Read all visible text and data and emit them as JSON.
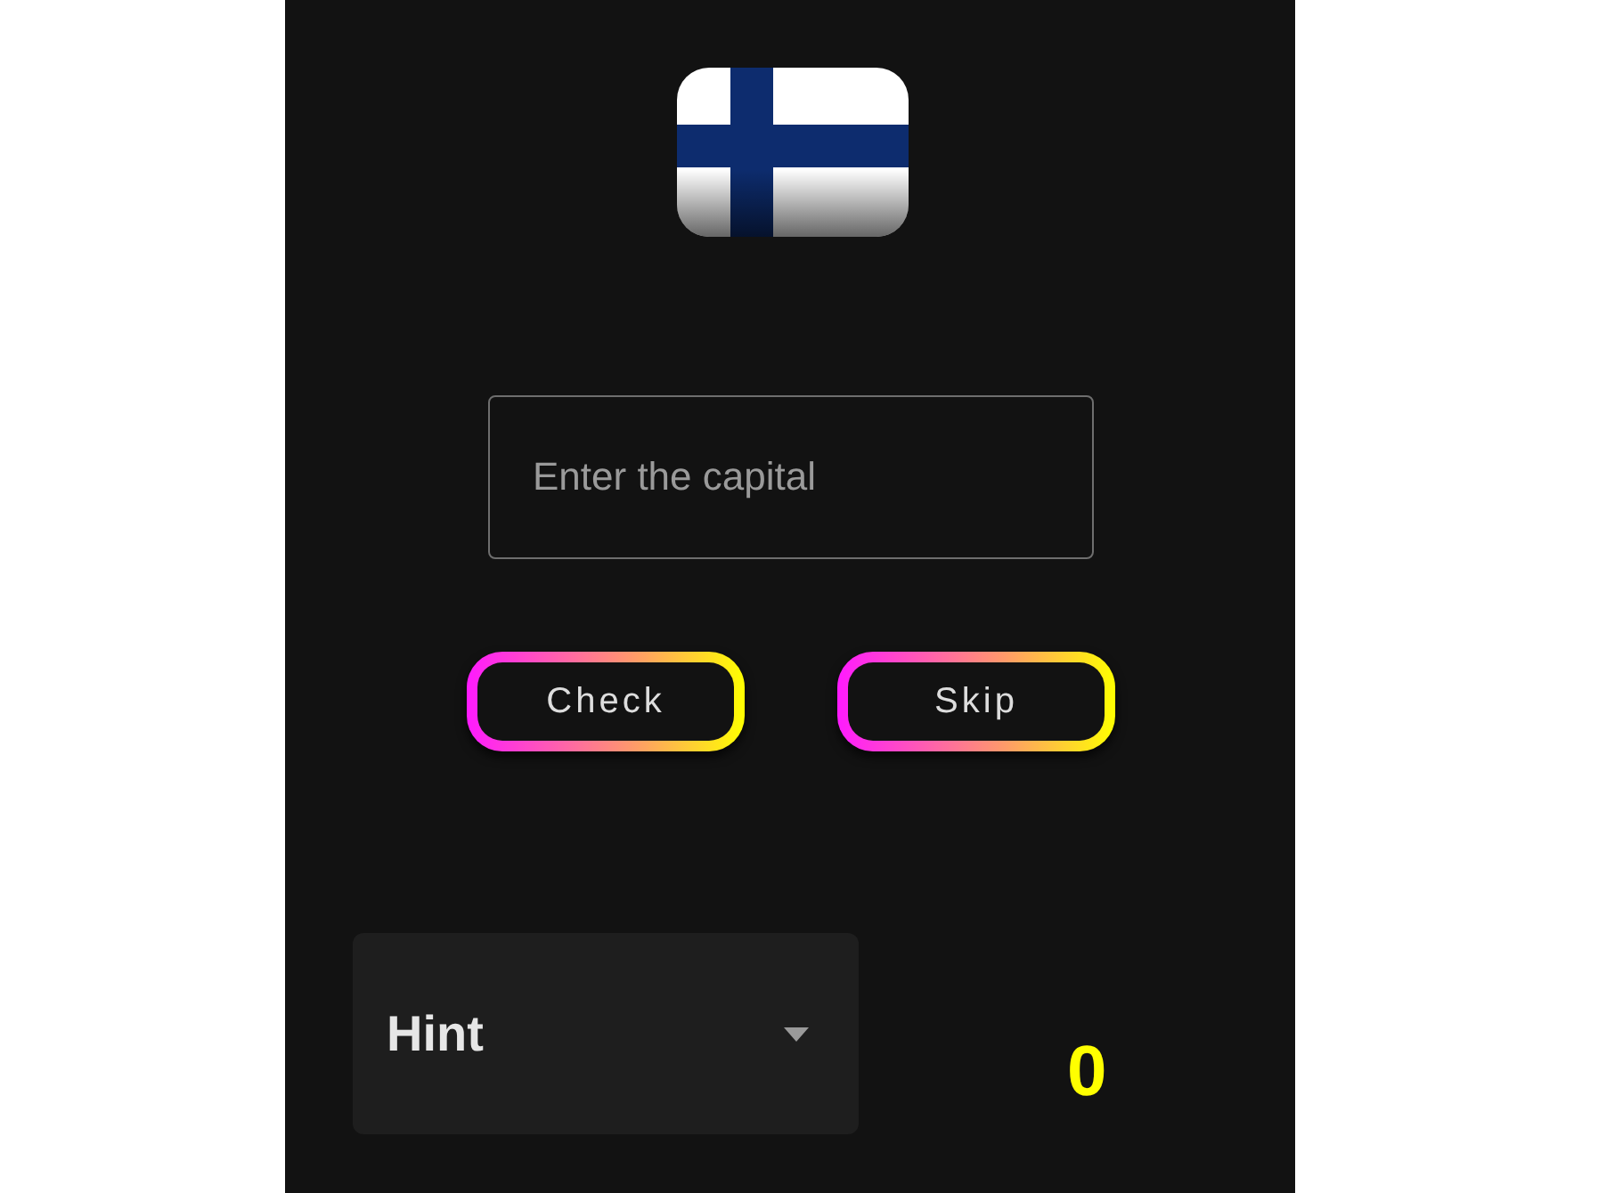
{
  "capital_field": {
    "placeholder": "Enter the capital"
  },
  "buttons": [
    {
      "label": "Check"
    },
    {
      "label": "Skip"
    }
  ],
  "hint_dropdown": {
    "label": "Hint",
    "expanded": false
  },
  "score": "0"
}
